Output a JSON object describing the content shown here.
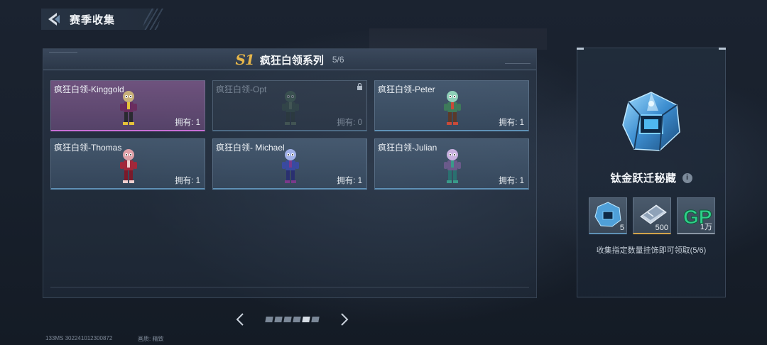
{
  "header": {
    "title": "赛季收集"
  },
  "series": {
    "badge": "S1",
    "title": "疯狂白领系列",
    "progress": "5/6"
  },
  "cards": [
    {
      "name": "疯狂白领-Kinggold",
      "owned_label": "拥有: 1",
      "rarity": "purple",
      "locked": false,
      "colors": {
        "hair": "#c9b27a",
        "body": "#6a2d5e",
        "pants": "#2a2a30",
        "accent": "#e6c23a"
      }
    },
    {
      "name": "疯狂白领-Opt",
      "owned_label": "拥有: 0",
      "rarity": "blue",
      "locked": true,
      "colors": {
        "hair": "#4f7a5a",
        "body": "#3a5a48",
        "pants": "#2a3a30",
        "accent": "#6a8a6a"
      }
    },
    {
      "name": "疯狂白领-Peter",
      "owned_label": "拥有: 1",
      "rarity": "blue",
      "locked": false,
      "colors": {
        "hair": "#8fd0b8",
        "body": "#3e7a5a",
        "pants": "#5a3a2a",
        "accent": "#c84a3a"
      }
    },
    {
      "name": "疯狂白领-Thomas",
      "owned_label": "拥有: 1",
      "rarity": "blue",
      "locked": false,
      "colors": {
        "hair": "#e0a0a8",
        "body": "#a2283a",
        "pants": "#7a1a2a",
        "accent": "#f0d0d0"
      }
    },
    {
      "name": "疯狂白领- Michael",
      "owned_label": "拥有: 1",
      "rarity": "blue",
      "locked": false,
      "colors": {
        "hair": "#a0b0e8",
        "body": "#3a4aa0",
        "pants": "#2a3070",
        "accent": "#7a3a8a"
      }
    },
    {
      "name": "疯狂白领-Julian",
      "owned_label": "拥有: 1",
      "rarity": "blue",
      "locked": false,
      "colors": {
        "hair": "#c8b0e0",
        "body": "#6a5a8a",
        "pants": "#2a7070",
        "accent": "#3a9a8a"
      }
    }
  ],
  "pager": {
    "total": 6,
    "active_index": 4
  },
  "reward": {
    "title": "钛金跃迁秘藏",
    "items": [
      {
        "icon": "crate-icon",
        "qty": "5"
      },
      {
        "icon": "ticket-icon",
        "qty": "500"
      },
      {
        "icon": "gp-currency-icon",
        "qty": "1万"
      }
    ],
    "description": "收集指定数量挂饰即可领取(5/6)"
  },
  "footer": {
    "ping": "133MS  302241012300872",
    "quality": "画质: 精致"
  },
  "colors": {
    "accent_blue": "#5f91b6",
    "accent_purple": "#c86fd6",
    "accent_gold": "#d2a34a",
    "badge_gold": "#e6b64a"
  }
}
